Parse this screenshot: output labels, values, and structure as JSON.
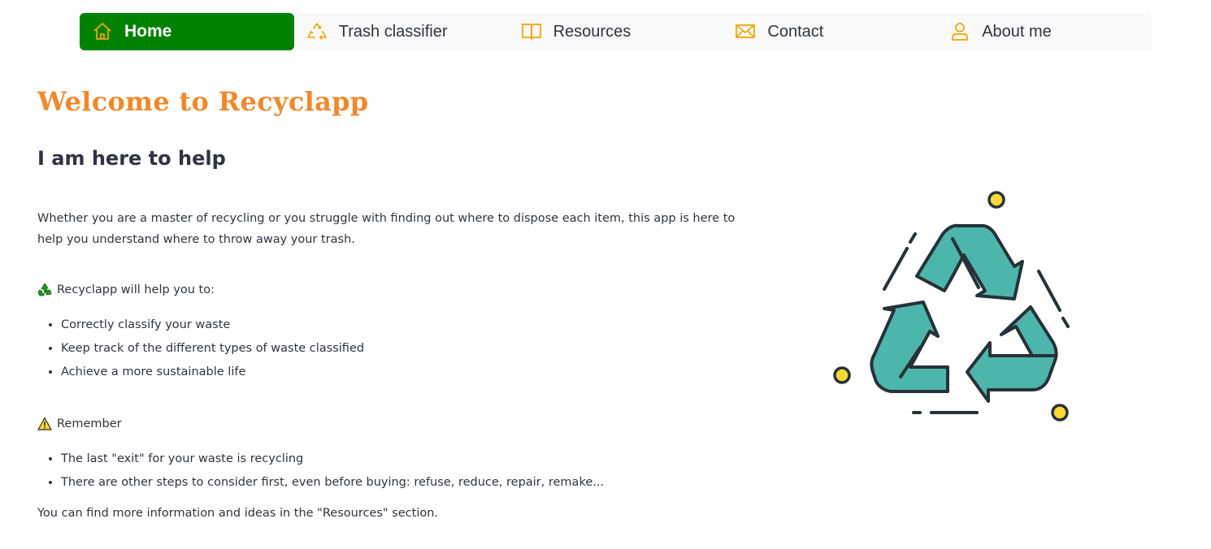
{
  "nav": {
    "items": [
      {
        "label": "Home",
        "icon": "house-icon",
        "active": true
      },
      {
        "label": "Trash classifier",
        "icon": "recycle-icon",
        "active": false
      },
      {
        "label": "Resources",
        "icon": "book-icon",
        "active": false
      },
      {
        "label": "Contact",
        "icon": "envelope-icon",
        "active": false
      },
      {
        "label": "About me",
        "icon": "person-icon",
        "active": false
      }
    ],
    "colors": {
      "active_bg": "#018101",
      "icon": "#f0a500",
      "bar_bg": "#f9f9f9"
    }
  },
  "main": {
    "title": "Welcome to Recyclapp",
    "subtitle": "I am here to help",
    "intro": "Whether you are a master of recycling or you struggle with finding out where to dispose each item, this app is here to help you understand where to throw away your trash.",
    "help_section": {
      "label": "Recyclapp will help you to:",
      "icon": "recycle-emoji-icon",
      "items": [
        "Correctly classify your waste",
        "Keep track of the different types of waste classified",
        "Achieve a more sustainable life"
      ]
    },
    "remember_section": {
      "label": "Remember",
      "icon": "warning-icon",
      "items": [
        "The last \"exit\" for your waste is recycling",
        "There are other steps to consider first, even before buying: refuse, reduce, repair, remake..."
      ]
    },
    "footer_text": "You can find more information and ideas in the \"Resources\" section.",
    "colors": {
      "title": "#f0892c",
      "recycle_fill": "#4db6ac",
      "outline": "#263238",
      "dots": "#fdd835"
    }
  }
}
